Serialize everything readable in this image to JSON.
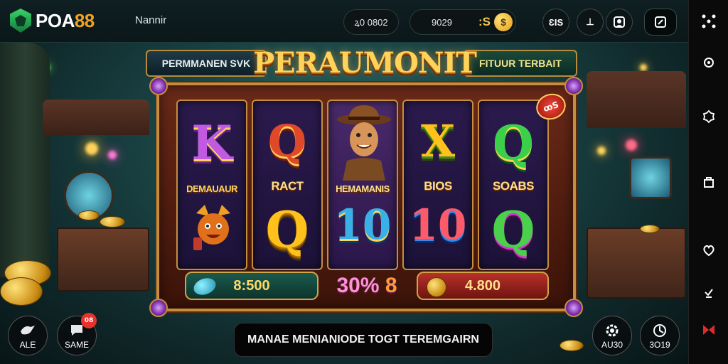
{
  "header": {
    "brand_main": "POA",
    "brand_accent": "88",
    "username": "Nannir",
    "balance": "ꝝ0 0802",
    "coins_left": "9029",
    "coins_mid": ":S",
    "coin_symbol": "$",
    "btn_a": "ƐIS",
    "btn_b": "⊥"
  },
  "banner": {
    "left": "PERMMANEN SVK",
    "title": "PERAUMONIT",
    "right": "FITUUR TERBAIT"
  },
  "reels": [
    {
      "top": "K",
      "caption": "DEMAUAUR",
      "bottom_icon": "fox-mascot-icon"
    },
    {
      "top": "Q",
      "caption": "RACT",
      "bottom": "Q"
    },
    {
      "top_icon": "explorer-character-icon",
      "caption": "HEMAMANIS",
      "bottom": "10"
    },
    {
      "top": "X",
      "caption": "BIOS",
      "bottom": "10"
    },
    {
      "top": "Q",
      "caption": "SOABS",
      "bottom": "Q"
    }
  ],
  "wins": {
    "left": "8:500",
    "mid": "30%",
    "mid_suffix": "8",
    "right": "4.800"
  },
  "hot_badge": "ꝏS",
  "bottom": {
    "message": "MANAE MENIANIODE TOGT TEREMGAIRN",
    "btn_left_label": "ALE",
    "btn_save_label": "SAME",
    "btn_save_badge": "08",
    "btn_auto_label": "AU30",
    "btn_spin_label": "3O19"
  },
  "colors": {
    "accent": "#f6a11a",
    "gold": "#c58e3e",
    "title": "#ffd35a",
    "win_left": "#1b5a4d",
    "win_right": "#b9302a"
  }
}
